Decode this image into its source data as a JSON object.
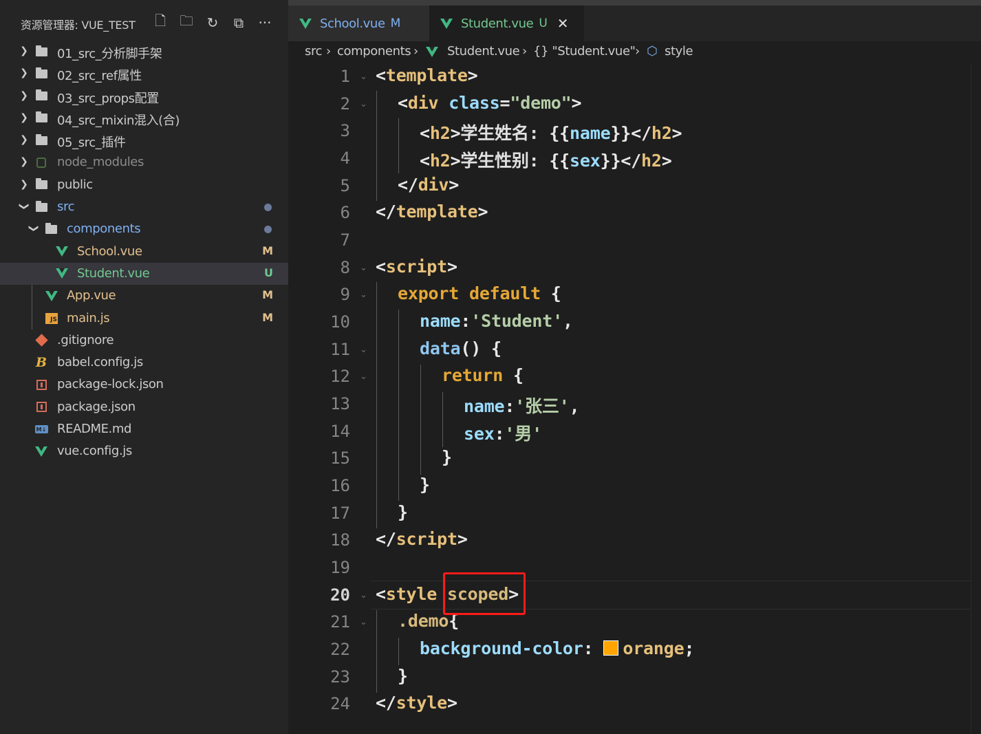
{
  "explorer": {
    "title": "资源管理器: VUE_TEST",
    "items": [
      {
        "label": "01_src_分析脚手架",
        "type": "folder",
        "badge": ""
      },
      {
        "label": "02_src_ref属性",
        "type": "folder",
        "badge": ""
      },
      {
        "label": "03_src_props配置",
        "type": "folder",
        "badge": ""
      },
      {
        "label": "04_src_mixin混入(合)",
        "type": "folder",
        "badge": ""
      },
      {
        "label": "05_src_插件",
        "type": "folder",
        "badge": ""
      },
      {
        "label": "node_modules",
        "type": "folder",
        "badge": ""
      },
      {
        "label": "public",
        "type": "folder",
        "badge": ""
      },
      {
        "label": "src",
        "type": "folder",
        "badge": ""
      },
      {
        "label": "components",
        "type": "folder",
        "badge": ""
      },
      {
        "label": "School.vue",
        "type": "vue",
        "badge": "M"
      },
      {
        "label": "Student.vue",
        "type": "vue",
        "badge": "U"
      },
      {
        "label": "App.vue",
        "type": "vue",
        "badge": "M"
      },
      {
        "label": "main.js",
        "type": "js",
        "badge": "M"
      },
      {
        "label": ".gitignore",
        "type": "git",
        "badge": ""
      },
      {
        "label": "babel.config.js",
        "type": "babel",
        "badge": ""
      },
      {
        "label": "package-lock.json",
        "type": "pkg",
        "badge": ""
      },
      {
        "label": "package.json",
        "type": "pkg",
        "badge": ""
      },
      {
        "label": "README.md",
        "type": "md",
        "badge": ""
      },
      {
        "label": "vue.config.js",
        "type": "vue",
        "badge": ""
      }
    ]
  },
  "tabs": [
    {
      "name": "School.vue",
      "badge": "M"
    },
    {
      "name": "Student.vue",
      "badge": "U"
    }
  ],
  "breadcrumb": {
    "p1": "src",
    "p2": "components",
    "p3": "Student.vue",
    "p4": "{} \"Student.vue\"",
    "p5": "style"
  },
  "code": {
    "line_numbers": [
      "1",
      "2",
      "3",
      "4",
      "5",
      "6",
      "7",
      "8",
      "9",
      "10",
      "11",
      "12",
      "13",
      "14",
      "15",
      "16",
      "17",
      "18",
      "19",
      "20",
      "21",
      "22",
      "23",
      "24"
    ],
    "l1": {
      "open": "<",
      "tag": "template",
      "close": ">"
    },
    "l2": {
      "indent": "  ",
      "open": "<",
      "tag": "div",
      "attr": "class",
      "eq": "=",
      "val": "\"demo\"",
      "close": ">"
    },
    "l3": {
      "open": "<",
      "tag": "h2",
      "close": ">",
      "text": "学生姓名: ",
      "mus_open": "{{",
      "var": "name",
      "mus_close": "}}",
      "end_open": "</",
      "end_tag": "h2",
      "end_close": ">"
    },
    "l4": {
      "open": "<",
      "tag": "h2",
      "close": ">",
      "text": "学生性别: ",
      "mus_open": "{{",
      "var": "sex",
      "mus_close": "}}",
      "end_open": "</",
      "end_tag": "h2",
      "end_close": ">"
    },
    "l5": {
      "open": "</",
      "tag": "div",
      "close": ">"
    },
    "l6": {
      "open": "</",
      "tag": "template",
      "close": ">"
    },
    "l8": {
      "open": "<",
      "tag": "script",
      "close": ">"
    },
    "l9": {
      "kw1": "export",
      "kw2": "default",
      "brace": "{"
    },
    "l10": {
      "key": "name",
      "colon": ":",
      "val": "'Student'",
      "comma": ","
    },
    "l11": {
      "fn": "data",
      "parens": "()",
      "brace": "{"
    },
    "l12": {
      "kw": "return",
      "brace": "{"
    },
    "l13": {
      "key": "name",
      "colon": ":",
      "val": "'张三'",
      "comma": ","
    },
    "l14": {
      "key": "sex",
      "colon": ":",
      "val": "'男'"
    },
    "l15": {
      "brace": "}"
    },
    "l16": {
      "brace": "}"
    },
    "l17": {
      "brace": "}"
    },
    "l18": {
      "open": "</",
      "tag": "script",
      "close": ">"
    },
    "l20": {
      "open": "<",
      "tag": "style",
      "attr": "scoped",
      "close": ">"
    },
    "l21": {
      "selector": ".demo",
      "brace": "{"
    },
    "l22": {
      "prop": "background-color",
      "colon": ":",
      "val": "orange",
      "semi": ";"
    },
    "l23": {
      "brace": "}"
    },
    "l24": {
      "open": "</",
      "tag": "style",
      "close": ">"
    }
  },
  "colors": {
    "swatch": "#ffa500",
    "highlight_box": "#ff1a1a",
    "modified_badge": "#e2c08d",
    "untracked_badge": "#73c991",
    "selected_folder": "#7fb0f0"
  }
}
